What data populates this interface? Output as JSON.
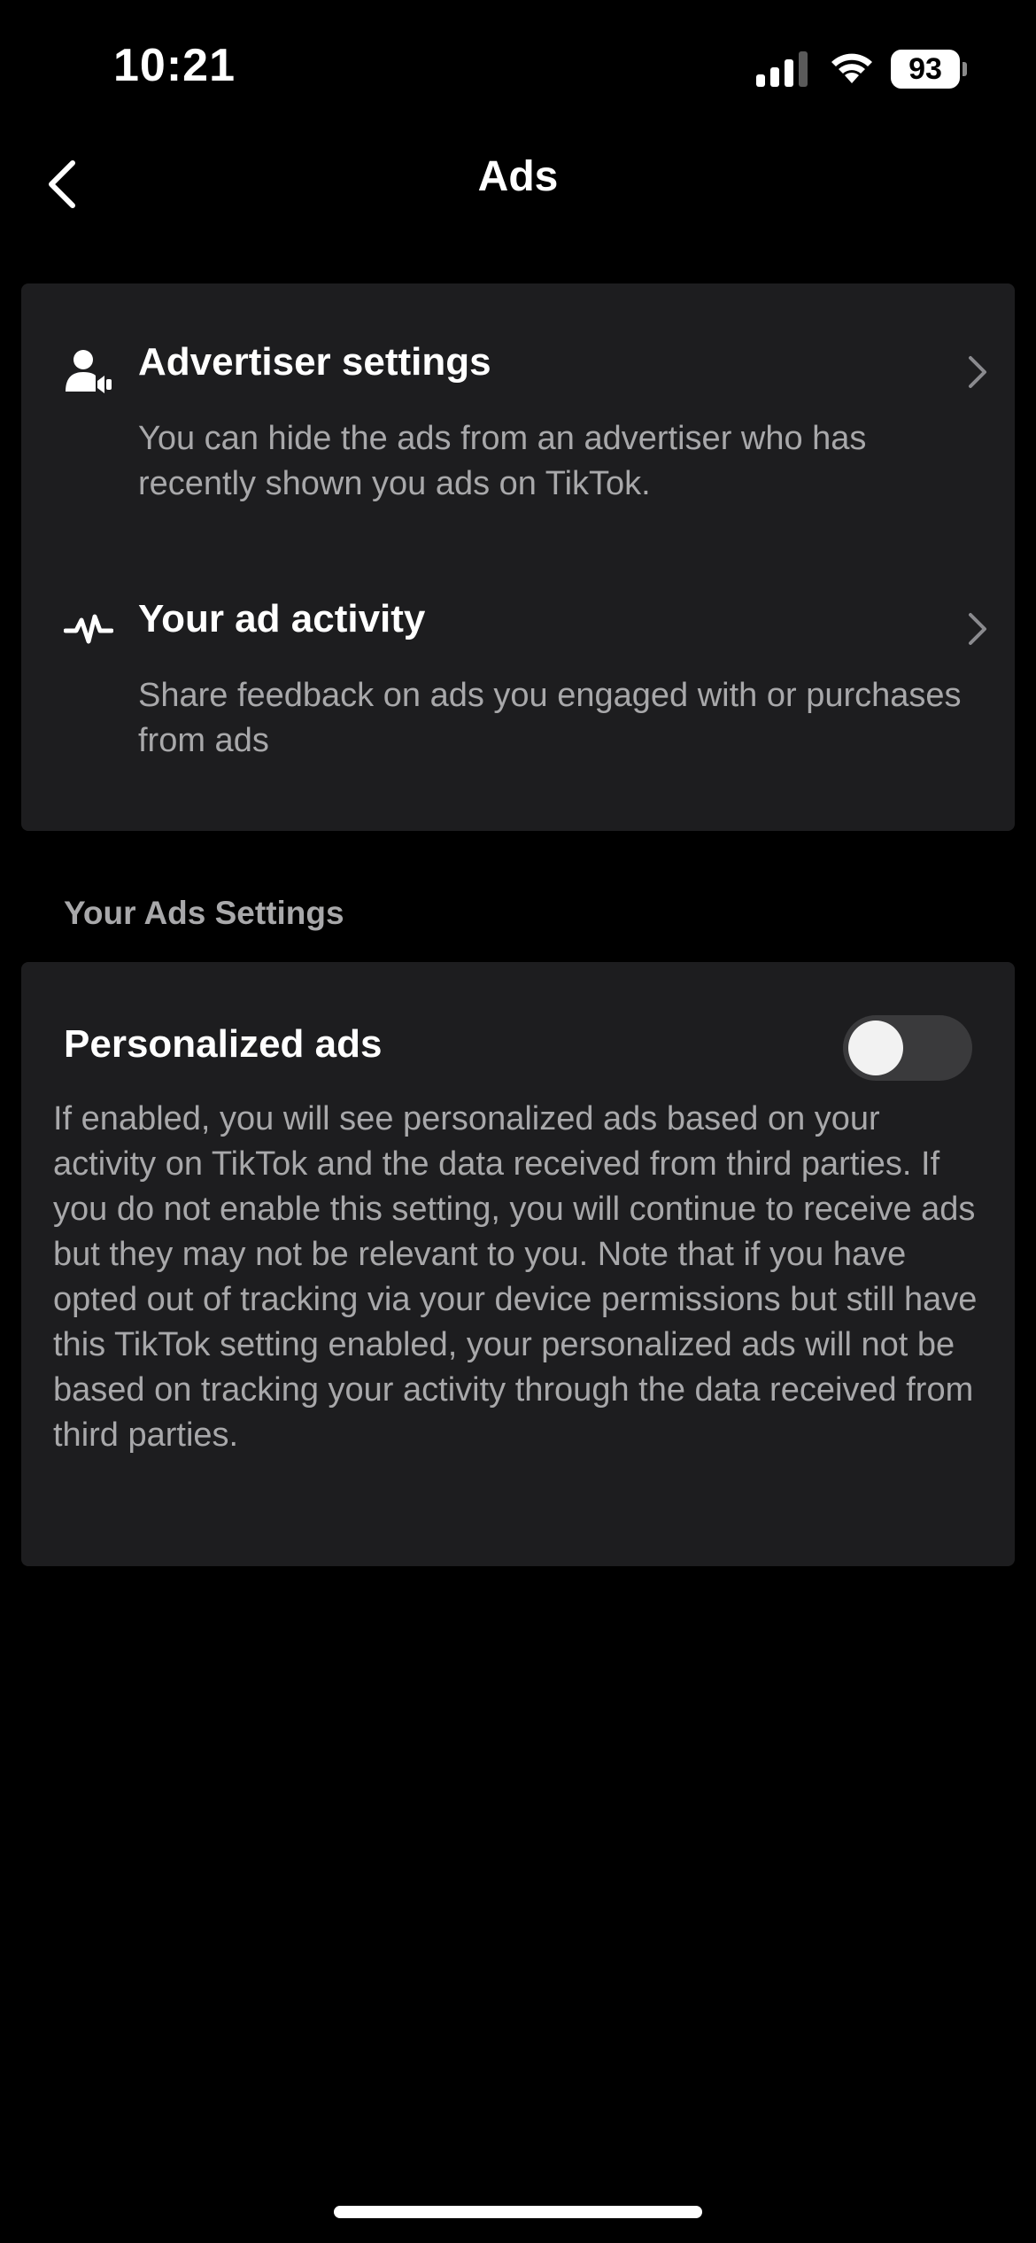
{
  "status_bar": {
    "time": "10:21",
    "battery": "93",
    "icons": [
      "signal-icon",
      "wifi-icon",
      "battery-icon"
    ]
  },
  "nav": {
    "title": "Ads",
    "back_icon": "chevron-left-icon"
  },
  "menu": {
    "items": [
      {
        "icon": "advertiser-icon",
        "title": "Advertiser settings",
        "description": "You can hide the ads from an advertiser who has recently shown you ads on TikTok."
      },
      {
        "icon": "activity-icon",
        "title": "Your ad activity",
        "description": "Share feedback on ads you engaged with or purchases from ads"
      }
    ]
  },
  "ads_settings": {
    "section_title": "Your Ads Settings",
    "personalized_ads": {
      "label": "Personalized ads",
      "enabled": false,
      "description": "If enabled, you will see personalized ads based on your activity on TikTok and the data received from third parties. If you do not enable this setting, you will continue to receive ads but they may not be relevant to you. Note that if you have opted out of tracking via your device permissions but still have this TikTok setting enabled, your personalized ads will not be based on tracking your activity through the data received from third parties."
    }
  },
  "colors": {
    "background": "#000000",
    "card": "#1d1d1f",
    "secondary_text": "#a8a8aa",
    "toggle_off": "#3a3a3c"
  }
}
